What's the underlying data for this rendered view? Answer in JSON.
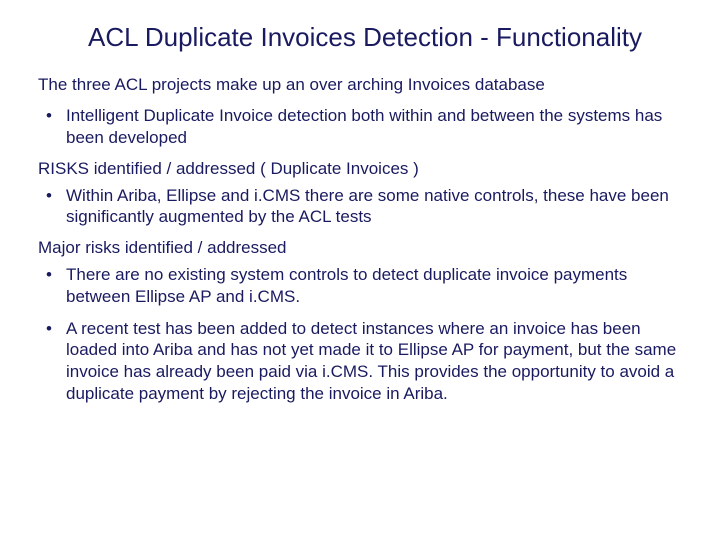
{
  "title": "ACL Duplicate Invoices Detection - Functionality",
  "intro": "The three ACL projects make up an over arching Invoices database",
  "bullets_intro": [
    "Intelligent Duplicate Invoice detection both within and between the systems has been developed"
  ],
  "risks_heading": "RISKS  identified / addressed ( Duplicate Invoices )",
  "bullets_risks": [
    "Within Ariba, Ellipse and i.CMS there are some native controls, these have been significantly augmented by the ACL tests"
  ],
  "major_heading": "Major risks identified / addressed",
  "bullets_major": [
    "There are no existing system controls to detect duplicate invoice payments between Ellipse AP and i.CMS.",
    "A recent test has been added to detect instances where an invoice has been loaded into Ariba and has not yet made it to Ellipse AP for payment, but the same invoice has already been paid via i.CMS. This provides the opportunity to avoid a duplicate payment by rejecting the invoice in Ariba."
  ]
}
